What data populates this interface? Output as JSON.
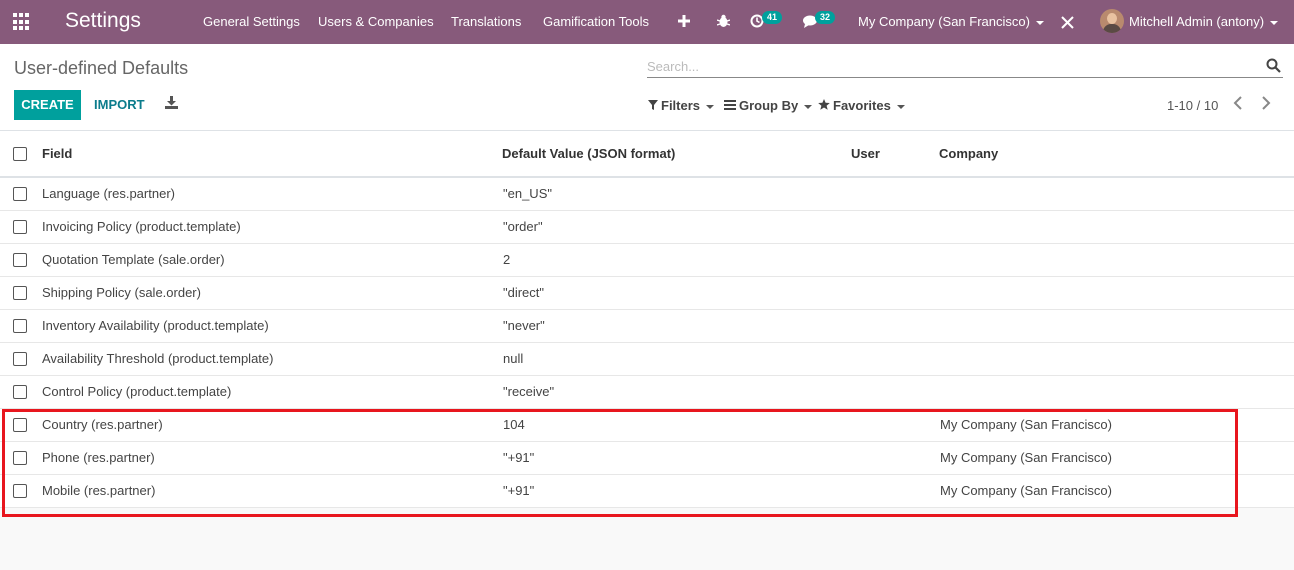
{
  "navbar": {
    "app_title": "Settings",
    "menu": [
      "General Settings",
      "Users & Companies",
      "Translations",
      "Gamification Tools"
    ],
    "activity_count": "41",
    "messages_count": "32",
    "company_switcher": "My Company (San Francisco)",
    "user_name": "Mitchell Admin (antony)"
  },
  "control_panel": {
    "title": "User-defined Defaults",
    "search_placeholder": "Search...",
    "create_label": "CREATE",
    "import_label": "IMPORT",
    "filters_label": "Filters",
    "group_by_label": "Group By",
    "favorites_label": "Favorites",
    "pager": "1-10 / 10"
  },
  "table": {
    "columns": [
      "Field",
      "Default Value (JSON format)",
      "User",
      "Company"
    ],
    "rows": [
      {
        "field": "Language (res.partner)",
        "value": "\"en_US\"",
        "user": "",
        "company": ""
      },
      {
        "field": "Invoicing Policy (product.template)",
        "value": "\"order\"",
        "user": "",
        "company": ""
      },
      {
        "field": "Quotation Template (sale.order)",
        "value": "2",
        "user": "",
        "company": ""
      },
      {
        "field": "Shipping Policy (sale.order)",
        "value": "\"direct\"",
        "user": "",
        "company": ""
      },
      {
        "field": "Inventory Availability (product.template)",
        "value": "\"never\"",
        "user": "",
        "company": ""
      },
      {
        "field": "Availability Threshold (product.template)",
        "value": "null",
        "user": "",
        "company": ""
      },
      {
        "field": "Control Policy (product.template)",
        "value": "\"receive\"",
        "user": "",
        "company": ""
      },
      {
        "field": "Country (res.partner)",
        "value": "104",
        "user": "",
        "company": "My Company (San Francisco)"
      },
      {
        "field": "Phone (res.partner)",
        "value": "\"+91\"",
        "user": "",
        "company": "My Company (San Francisco)"
      },
      {
        "field": "Mobile (res.partner)",
        "value": "\"+91\"",
        "user": "",
        "company": "My Company (San Francisco)"
      }
    ]
  },
  "colors": {
    "navbar": "#875a7b",
    "primary_button": "#00a09d",
    "highlight_box": "#e8161e"
  }
}
